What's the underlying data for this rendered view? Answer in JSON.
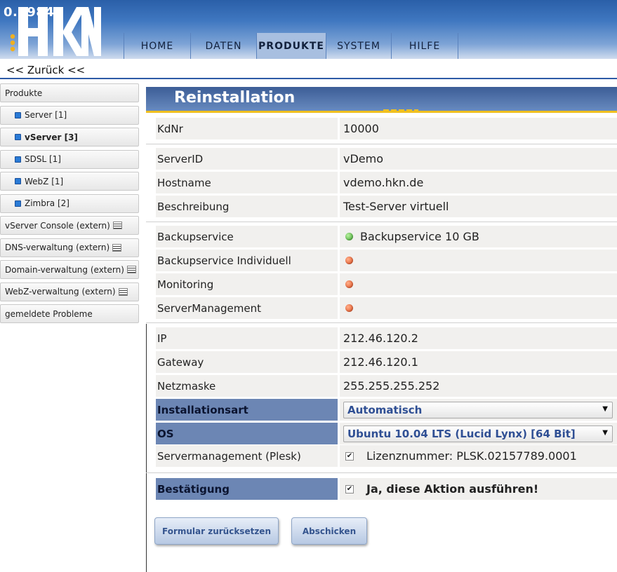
{
  "header": {
    "counter": "0.09846",
    "logo_text": "HKN",
    "nav": [
      {
        "label": "HOME",
        "active": false
      },
      {
        "label": "DATEN",
        "active": false
      },
      {
        "label": "PRODUKTE",
        "active": true
      },
      {
        "label": "SYSTEM",
        "active": false
      },
      {
        "label": "HILFE",
        "active": false
      }
    ]
  },
  "back_link": "<< Zurück <<",
  "sidebar": {
    "items": [
      {
        "label": "Produkte",
        "type": "section"
      },
      {
        "label": "Server [1]",
        "type": "sub"
      },
      {
        "label": "vServer [3]",
        "type": "sub",
        "active": true
      },
      {
        "label": "SDSL [1]",
        "type": "sub"
      },
      {
        "label": "WebZ [1]",
        "type": "sub"
      },
      {
        "label": "Zimbra [2]",
        "type": "sub"
      },
      {
        "label": "vServer Console (extern)",
        "type": "external"
      },
      {
        "label": "DNS-verwaltung (extern)",
        "type": "external"
      },
      {
        "label": "Domain-verwaltung (extern)",
        "type": "external"
      },
      {
        "label": "WebZ-verwaltung (extern)",
        "type": "external"
      },
      {
        "label": "gemeldete Probleme",
        "type": "section"
      }
    ]
  },
  "main": {
    "title": "Reinstallation",
    "fields": {
      "kdnr": {
        "label": "KdNr",
        "value": "10000"
      },
      "serverid": {
        "label": "ServerID",
        "value": "vDemo"
      },
      "hostname": {
        "label": "Hostname",
        "value": "vdemo.hkn.de"
      },
      "beschreibung": {
        "label": "Beschreibung",
        "value": "Test-Server virtuell"
      },
      "backupservice": {
        "label": "Backupservice",
        "value": "Backupservice 10 GB",
        "status": "green"
      },
      "backup_individuell": {
        "label": "Backupservice Individuell",
        "value": "",
        "status": "red"
      },
      "monitoring": {
        "label": "Monitoring",
        "value": "",
        "status": "red"
      },
      "servermanagement": {
        "label": "ServerManagement",
        "value": "",
        "status": "red"
      },
      "ip": {
        "label": "IP",
        "value": "212.46.120.2"
      },
      "gateway": {
        "label": "Gateway",
        "value": "212.46.120.1"
      },
      "netzmaske": {
        "label": "Netzmaske",
        "value": "255.255.255.252"
      },
      "installationsart": {
        "label": "Installationsart",
        "selected": "Automatisch"
      },
      "os": {
        "label": "OS",
        "selected": "Ubuntu 10.04 LTS (Lucid Lynx) [64 Bit]"
      },
      "plesk": {
        "label": "Servermanagement (Plesk)",
        "checked": true,
        "value": "Lizenznummer: PLSK.02157789.0001"
      },
      "bestaetigung": {
        "label": "Bestätigung",
        "checked": true,
        "value": "Ja, diese Aktion ausführen!"
      }
    },
    "buttons": {
      "reset": "Formular zurücksetzen",
      "submit": "Abschicken"
    }
  },
  "colors": {
    "header_blue": "#2a5fa8",
    "title_bar": "#3c5d96",
    "highlight_label": "#6c86b4",
    "accent_yellow": "#f0c020",
    "select_text": "#2f4f94"
  }
}
